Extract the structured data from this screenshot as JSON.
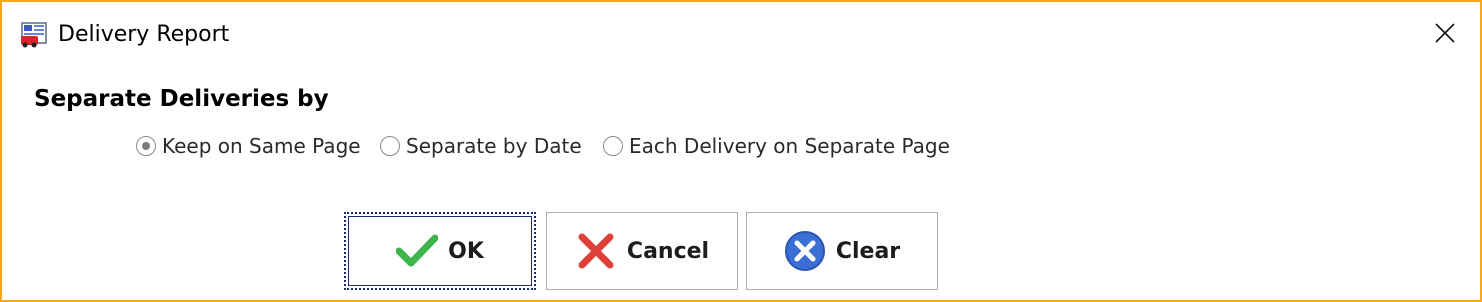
{
  "window": {
    "title": "Delivery Report",
    "icon": "report-icon",
    "border_color": "#f5a623"
  },
  "section": {
    "label": "Separate Deliveries by"
  },
  "radio_options": [
    {
      "label": "Keep on Same Page",
      "checked": true
    },
    {
      "label": "Separate by Date",
      "checked": false
    },
    {
      "label": "Each Delivery on Separate Page",
      "checked": false
    }
  ],
  "buttons": {
    "ok": {
      "label": "OK",
      "icon": "check-icon",
      "icon_color": "#3cb54a"
    },
    "cancel": {
      "label": "Cancel",
      "icon": "x-icon",
      "icon_color": "#e0403a"
    },
    "clear": {
      "label": "Clear",
      "icon": "clear-circle-icon",
      "icon_color": "#3b6fd6"
    }
  }
}
